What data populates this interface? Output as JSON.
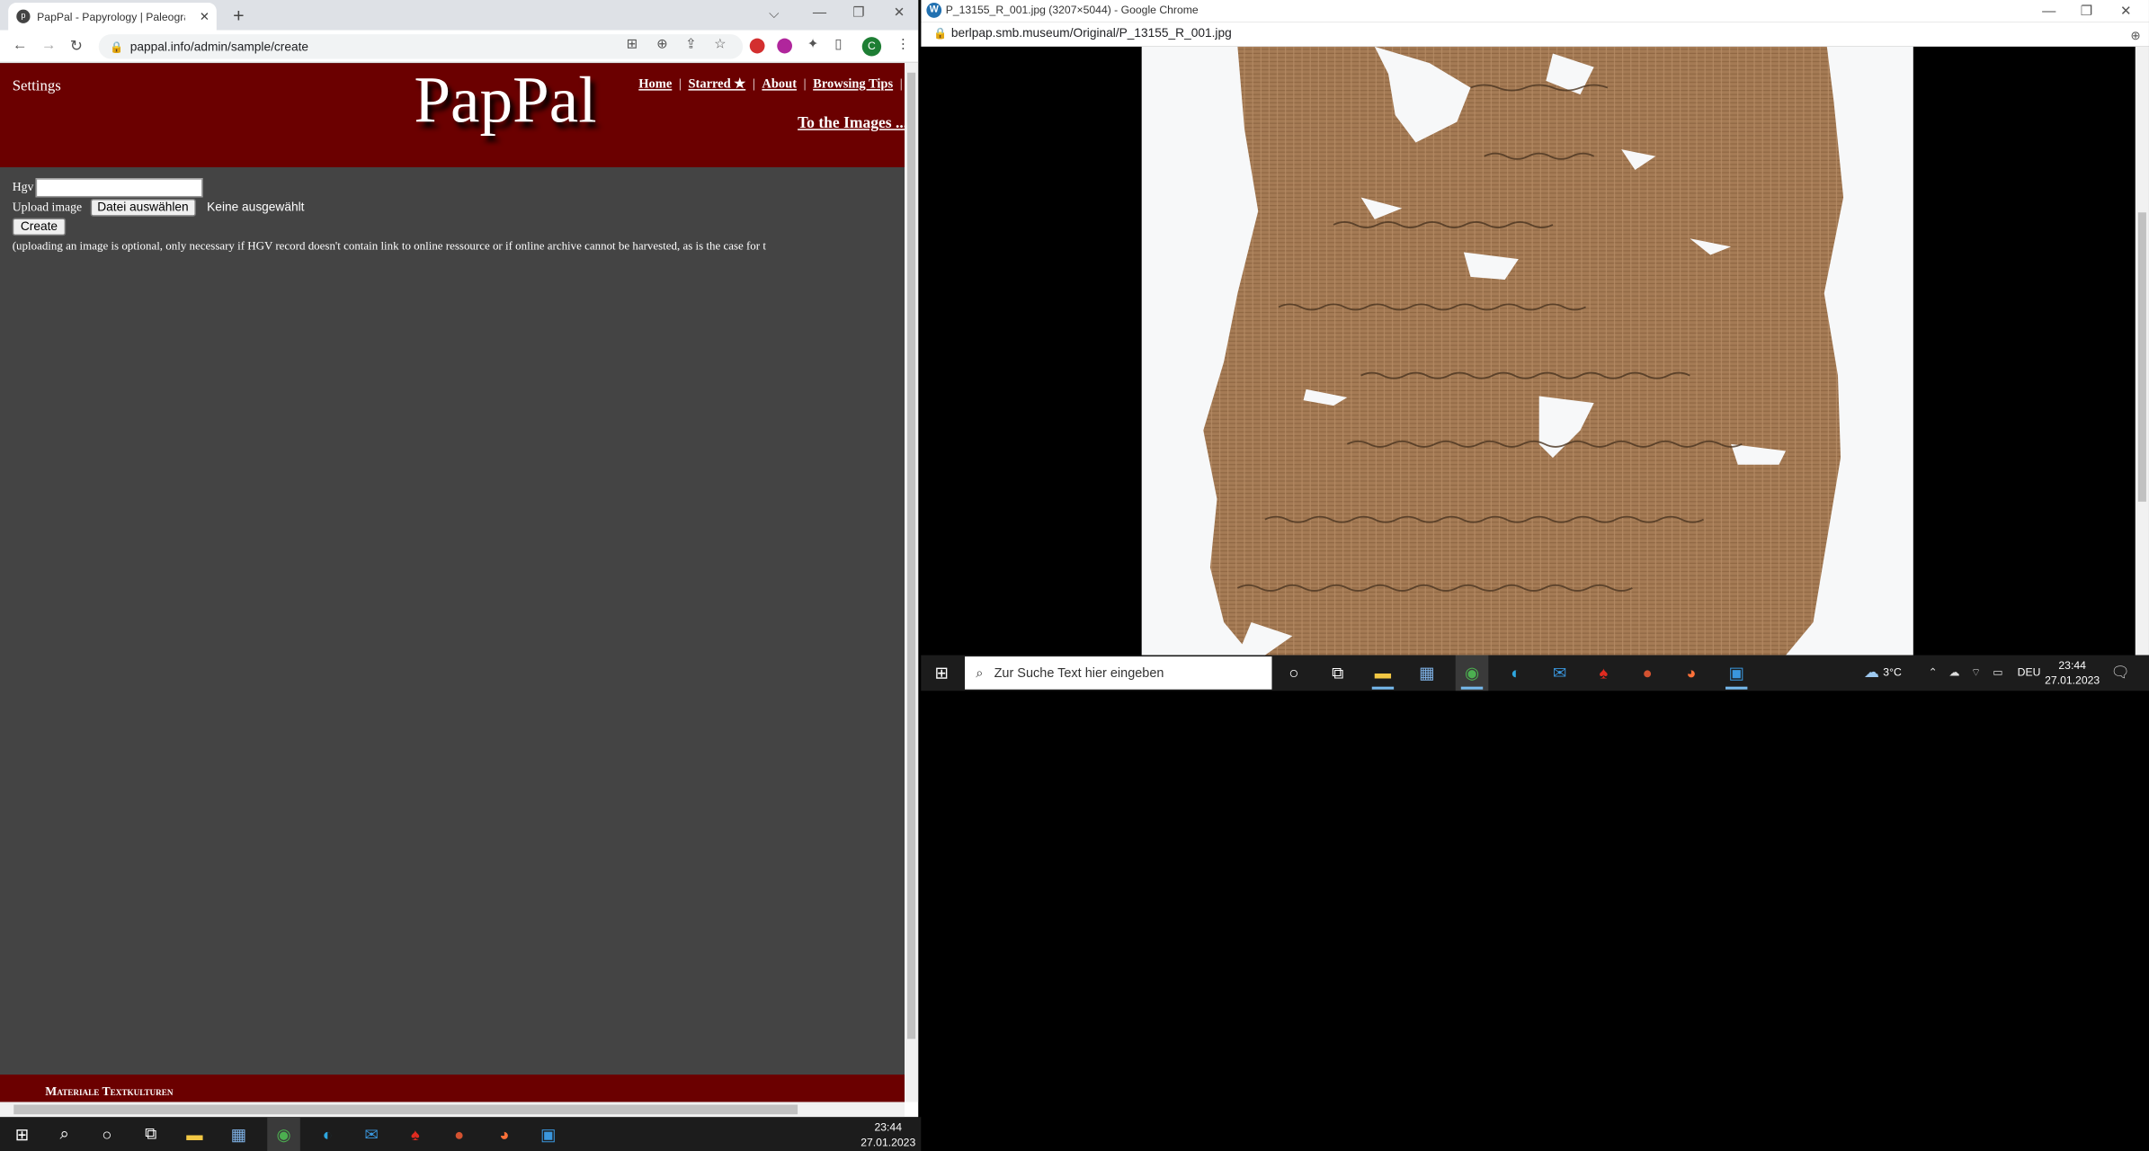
{
  "left_browser": {
    "tab_title": "PapPal - Papyrology | Paleograph",
    "url": "pappal.info/admin/sample/create",
    "avatar_letter": "C",
    "page": {
      "settings_label": "Settings",
      "logo": "PapPal",
      "nav": [
        "Home",
        "Starred ★",
        "About",
        "Browsing Tips"
      ],
      "to_images": "To the Images ...",
      "hgv_label": "Hgv",
      "hgv_value": "",
      "upload_label": "Upload image",
      "file_button": "Datei auswählen",
      "file_status": "Keine ausgewählt",
      "create_button": "Create",
      "note": "(uploading an image is optional, only necessary if HGV record doesn't contain link to online ressource or if online archive cannot be harvested, as is the case for t",
      "footer_text": "Materiale Textkulturen"
    }
  },
  "right_browser": {
    "title": "P_13155_R_001.jpg (3207×5044) - Google Chrome",
    "url": "berlpap.smb.museum/Original/P_13155_R_001.jpg"
  },
  "right_taskbar": {
    "search_placeholder": "Zur Suche Text hier eingeben",
    "weather": "3°C",
    "language": "DEU",
    "time": "23:44",
    "date": "27.01.2023"
  },
  "left_taskbar": {
    "time": "23:44",
    "date": "27.01.2023"
  },
  "colors": {
    "header_bg": "#6b0000",
    "page_bg": "#444444"
  }
}
